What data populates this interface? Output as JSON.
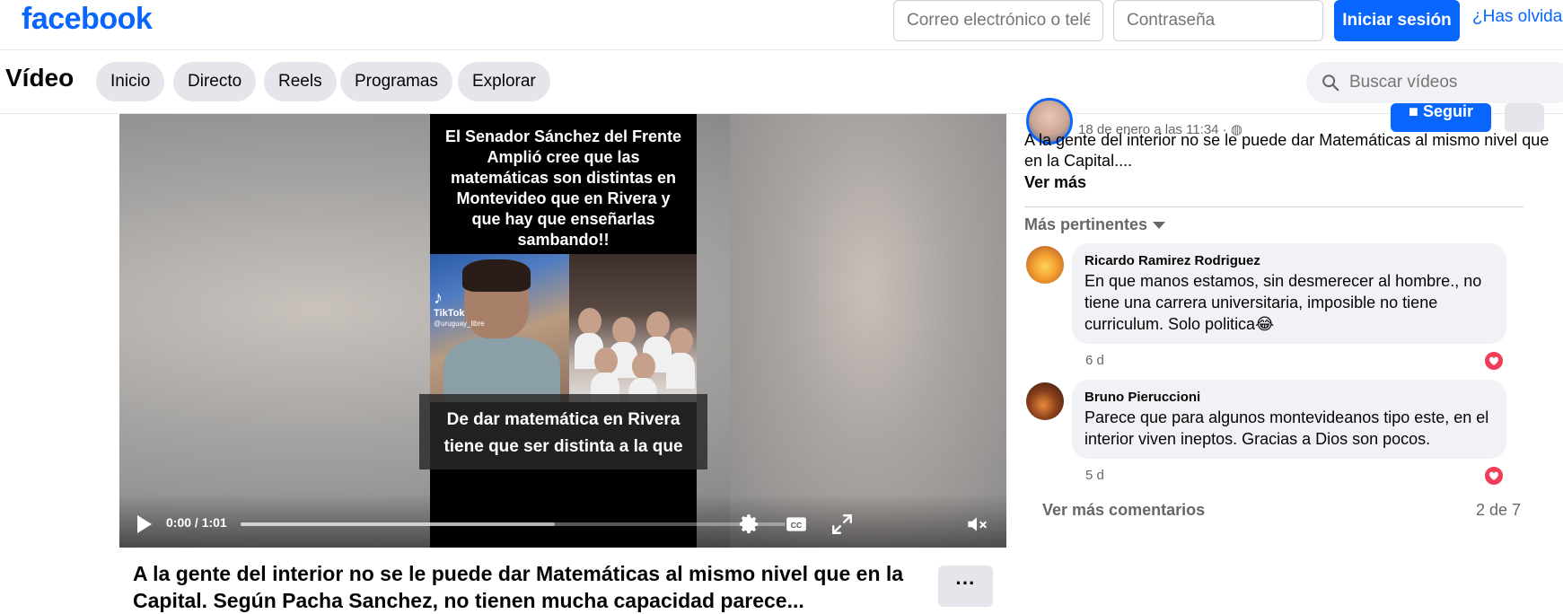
{
  "header": {
    "logo": "facebook",
    "email_placeholder": "Correo electrónico o teléfono",
    "password_placeholder": "Contraseña",
    "login_label": "Iniciar sesión",
    "forgot_label": "¿Has olvidado"
  },
  "subnav": {
    "title": "Vídeo",
    "tabs": [
      "Inicio",
      "Directo",
      "Reels",
      "Programas",
      "Explorar"
    ],
    "search_placeholder": "Buscar vídeos"
  },
  "video": {
    "overlay_title": "El Senador Sánchez del Frente Amplió cree que las matemáticas son distintas en Montevideo que en Rivera y que hay que enseñarlas sambando!!",
    "tiktok_label": "TikTok",
    "tiktok_handle": "@uruguay_libre",
    "caption_line1": "De dar matemática en Rivera",
    "caption_line2": "tiene que ser distinta a la que",
    "time": "0:00 / 1:01",
    "progress": 0,
    "icons": [
      "play-icon",
      "settings-icon",
      "captions-icon",
      "fullscreen-icon",
      "mute-icon"
    ],
    "title": "A la gente del interior no se le puede dar Matemáticas al mismo nivel que en la Capital. Según Pacha Sanchez, no tienen mucha capacidad parece..."
  },
  "post": {
    "date": "18 de enero a las 11:34 · ",
    "follow_label": "Seguir",
    "text": "A la gente del interior no se le puede dar Matemáticas al mismo nivel que en la Capital....",
    "see_more": "Ver más",
    "sort_label": "Más pertinentes"
  },
  "comments": [
    {
      "name": "Ricardo Ramirez Rodriguez",
      "text": "En que manos estamos, sin desmerecer al hombre., no tiene una carrera universitaria, imposible no tiene curriculum. Solo politica😂",
      "age": "6 d",
      "reaction": "heart-icon"
    },
    {
      "name": "Bruno Pieruccioni",
      "text": "Parece que para algunos montevideanos tipo este, en el interior viven ineptos. Gracias a Dios son pocos.",
      "age": "5 d",
      "reaction": "heart-icon"
    }
  ],
  "footer": {
    "more_comments": "Ver más comentarios",
    "count": "2 de 7"
  },
  "colors": {
    "brand": "#0866ff",
    "heart": "#f33e58",
    "muted_text": "#65676b"
  }
}
